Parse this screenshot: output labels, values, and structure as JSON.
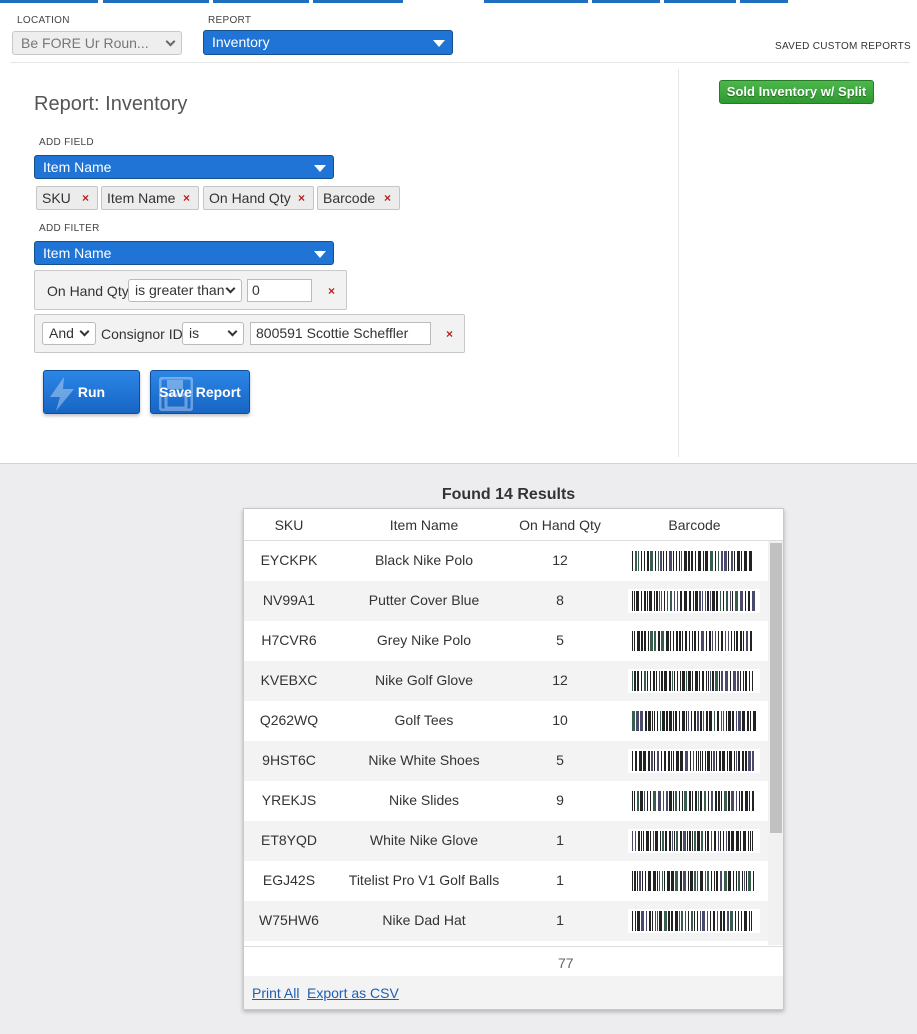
{
  "colors": {
    "primary_blue": "#1f74d6",
    "green_button": "#3aa63a",
    "remove_x": "#bb2222",
    "link": "#1f5fb0"
  },
  "filters_bar": {
    "location_label": "LOCATION",
    "location_value": "Be FORE Ur Roun...",
    "report_label": "REPORT",
    "report_value": "Inventory",
    "saved_custom_reports": "SAVED CUSTOM REPORTS"
  },
  "saved_reports": [
    {
      "label": "Sold Inventory w/ Split"
    }
  ],
  "builder": {
    "title": "Report: Inventory",
    "add_field_label": "ADD FIELD",
    "add_field_value": "Item Name",
    "fields": [
      {
        "label": "SKU"
      },
      {
        "label": "Item Name"
      },
      {
        "label": "On Hand Qty"
      },
      {
        "label": "Barcode"
      }
    ],
    "remove_symbol": "×",
    "add_filter_label": "ADD FILTER",
    "add_filter_value": "Item Name",
    "filter1": {
      "field": "On Hand Qty",
      "operator": "is greater than",
      "value": "0"
    },
    "filter2": {
      "conjunction": "And",
      "field": "Consignor ID",
      "operator": "is",
      "value": "800591 Scottie  Scheffler"
    },
    "run_label": "Run",
    "save_label": "Save Report"
  },
  "results": {
    "found_text": "Found 14 Results",
    "columns": [
      "SKU",
      "Item Name",
      "On Hand Qty",
      "Barcode"
    ],
    "rows": [
      {
        "sku": "EYCKPK",
        "name": "Black Nike Polo",
        "qty": "12"
      },
      {
        "sku": "NV99A1",
        "name": "Putter Cover Blue",
        "qty": "8"
      },
      {
        "sku": "H7CVR6",
        "name": "Grey Nike Polo",
        "qty": "5"
      },
      {
        "sku": "KVEBXC",
        "name": "Nike Golf Glove",
        "qty": "12"
      },
      {
        "sku": "Q262WQ",
        "name": "Golf Tees",
        "qty": "10"
      },
      {
        "sku": "9HST6C",
        "name": "Nike White Shoes",
        "qty": "5"
      },
      {
        "sku": "YREKJS",
        "name": "Nike Slides",
        "qty": "9"
      },
      {
        "sku": "ET8YQD",
        "name": "White Nike Glove",
        "qty": "1"
      },
      {
        "sku": "EGJ42S",
        "name": "Titelist Pro V1 Golf Balls",
        "qty": "1"
      },
      {
        "sku": "W75HW6",
        "name": "Nike Dad Hat",
        "qty": "1"
      }
    ],
    "total_qty": "77",
    "print_all": "Print All",
    "export_csv": "Export as CSV"
  }
}
